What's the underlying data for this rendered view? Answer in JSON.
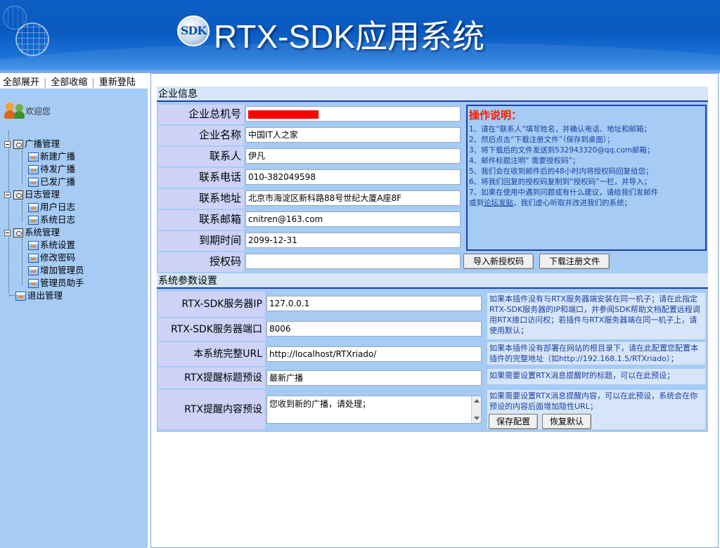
{
  "header": {
    "logo_text": "SDK",
    "title": "RTX-SDK应用系统"
  },
  "sidebar": {
    "top_links": [
      "全部展开",
      "全部收缩",
      "重新登陆"
    ],
    "welcome": "欢迎您",
    "groups": [
      {
        "label": "广播管理",
        "items": [
          "新建广播",
          "待发广播",
          "已发广播"
        ]
      },
      {
        "label": "日志管理",
        "items": [
          "用户日志",
          "系统日志"
        ]
      },
      {
        "label": "系统管理",
        "items": [
          "系统设置",
          "修改密码",
          "增加管理员",
          "管理员助手"
        ]
      }
    ],
    "logout": "退出管理"
  },
  "company": {
    "section_title": "企业信息",
    "fields": [
      {
        "label": "企业总机号",
        "value": ""
      },
      {
        "label": "企业名称",
        "value": "中国IT人之家"
      },
      {
        "label": "联系人",
        "value": "伊凡"
      },
      {
        "label": "联系电话",
        "value": "010-382049598"
      },
      {
        "label": "联系地址",
        "value": "北京市海淀区新科路88号世纪大厦A座8F"
      },
      {
        "label": "联系邮箱",
        "value": "cnitren@163.com"
      },
      {
        "label": "到期时间",
        "value": "2099-12-31"
      },
      {
        "label": "授权码",
        "value": ""
      }
    ],
    "buttons": {
      "import": "导入新授权码",
      "download": "下载注册文件"
    },
    "instructions": {
      "title": "操作说明：",
      "lines": [
        "1、请在“联系人”填写姓名，并确认电话、地址和邮箱；",
        "2、然后点击“下载注册文件”（保存到桌面）；",
        "3、将下载后的文件发送到532943320@qq.com邮箱；",
        "4、邮件标题注明“ 需要授权码”；",
        "5、我们会在收到邮件后的48小时内将授权码回复给您；",
        "6、将我们回复的授权码复制到“授权码”一栏，并导入；",
        "7、如果在使用中遇到问题或有什么建议，请给我们发邮件"
      ],
      "last_line_prefix": "或到",
      "last_line_link": "论坛发贴",
      "last_line_suffix": "，我们虚心听取并改进我们的系统；"
    }
  },
  "system": {
    "section_title": "系统参数设置",
    "fields": [
      {
        "label": "RTX-SDK服务器IP",
        "value": "127.0.0.1"
      },
      {
        "label": "RTX-SDK服务器端口",
        "value": "8006"
      },
      {
        "label": "本系统完整URL",
        "value": "http://localhost/RTXriado/"
      },
      {
        "label": "RTX提醒标题预设",
        "value": "最新广播"
      },
      {
        "label": "RTX提醒内容预设",
        "value": "您收到新的广播，请处理；"
      }
    ],
    "hints": [
      "如果本插件没有与RTX服务器端安装在同一机子；请在此指定RTX-SDK服务器的IP和端口，并参阅SDK帮助文档配置远程调用RTX接口访问权；若插件与RTX服务器端在同一机子上，请使用默认；",
      "如果本插件没有部署在网站的根目录下，请在此配置您配置本插件的完整地址（如http://192.168.1.5/RTXriado）；",
      "如果需要设置RTX消息提醒时的标题，可以在此预设；",
      "如果需要设置RTX消息提醒内容，可以在此预设，系统会在你预设的内容后面增加隐性URL；"
    ],
    "buttons": {
      "save": "保存配置",
      "restore": "恢复默认"
    }
  }
}
